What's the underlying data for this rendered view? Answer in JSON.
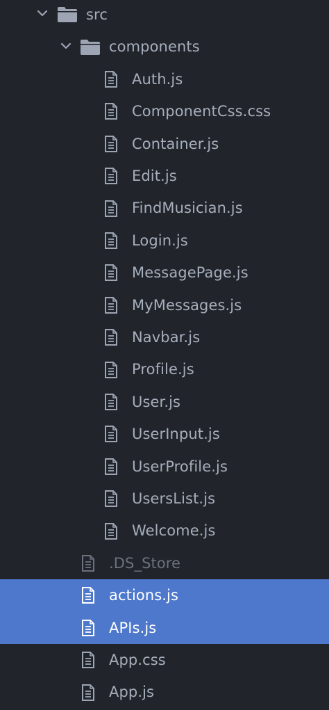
{
  "tree": {
    "src": {
      "label": "src",
      "expanded": true
    },
    "components": {
      "label": "components",
      "expanded": true
    },
    "component_files": [
      {
        "label": "Auth.js"
      },
      {
        "label": "ComponentCss.css"
      },
      {
        "label": "Container.js"
      },
      {
        "label": "Edit.js"
      },
      {
        "label": "FindMusician.js"
      },
      {
        "label": "Login.js"
      },
      {
        "label": "MessagePage.js"
      },
      {
        "label": "MyMessages.js"
      },
      {
        "label": "Navbar.js"
      },
      {
        "label": "Profile.js"
      },
      {
        "label": "User.js"
      },
      {
        "label": "UserInput.js"
      },
      {
        "label": "UserProfile.js"
      },
      {
        "label": "UsersList.js"
      },
      {
        "label": "Welcome.js"
      }
    ],
    "src_files": [
      {
        "label": ".DS_Store",
        "ignored": true,
        "selected": false
      },
      {
        "label": "actions.js",
        "ignored": false,
        "selected": true
      },
      {
        "label": "APIs.js",
        "ignored": false,
        "selected": true
      },
      {
        "label": "App.css",
        "ignored": false,
        "selected": false
      },
      {
        "label": "App.js",
        "ignored": false,
        "selected": false
      }
    ]
  },
  "colors": {
    "background": "#21252b",
    "selection": "#4d78cc",
    "text": "#a7aebb",
    "text_ignored": "#6b717d",
    "text_selected": "#ffffff"
  },
  "icons": {
    "chevron": "chevron-down-icon",
    "folder": "folder-icon",
    "file": "file-text-icon"
  }
}
